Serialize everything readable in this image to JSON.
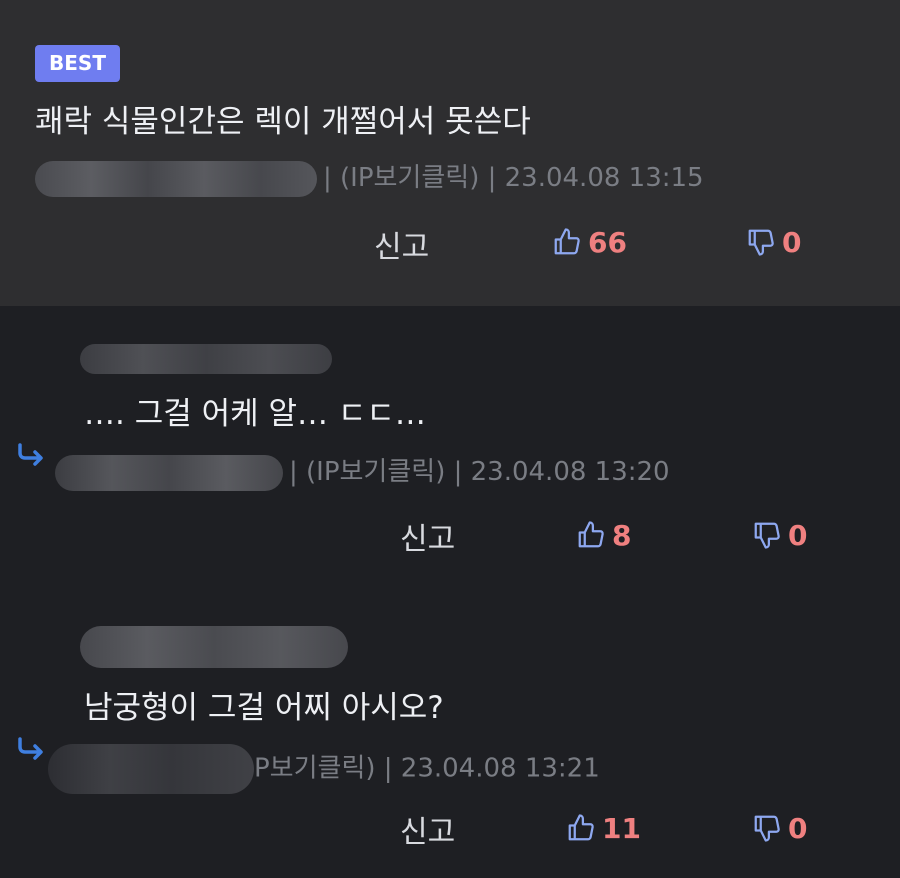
{
  "best": {
    "badge": "BEST",
    "text": "쾌락 식물인간은 렉이 개쩔어서 못쓴다",
    "meta": "| (IP보기클릭) | 23.04.08 13:15",
    "report_label": "신고",
    "upvotes": "66",
    "downvotes": "0"
  },
  "replies": [
    {
      "text": "…. 그걸 어케 알… ㄷㄷ…",
      "meta": "| (IP보기클릭) | 23.04.08 13:20",
      "report_label": "신고",
      "upvotes": "8",
      "downvotes": "0"
    },
    {
      "text": "남궁형이 그걸 어찌 아시오?",
      "meta": "P보기클릭) | 23.04.08 13:21",
      "report_label": "신고",
      "upvotes": "11",
      "downvotes": "0"
    }
  ],
  "colors": {
    "badge": "#6f7df0",
    "vote_count": "#ef8080",
    "icon": "#8ea8f0",
    "reply_arrow": "#3f7fe0"
  }
}
